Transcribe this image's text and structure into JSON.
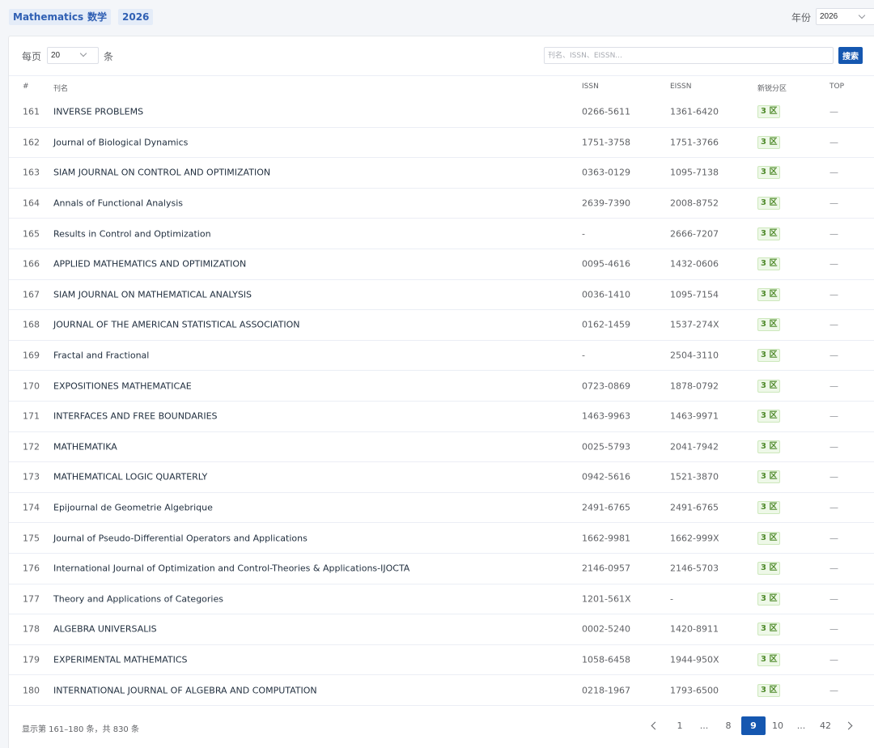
{
  "header": {
    "subject": "Mathematics",
    "subject_cn": "数学",
    "year_tag": "2026",
    "year_label": "年份",
    "year_value": "2026"
  },
  "toolbar": {
    "per_page_label": "每页",
    "per_page_value": "20",
    "per_page_unit": "条",
    "search_placeholder": "刊名、ISSN、EISSN...",
    "search_button": "搜索"
  },
  "table": {
    "columns": [
      "#",
      "刊名",
      "ISSN",
      "EISSN",
      "新锐分区",
      "TOP"
    ],
    "rows": [
      {
        "idx": "161",
        "name": "INVERSE PROBLEMS",
        "issn": "0266-5611",
        "eissn": "1361-6420",
        "zone": "3 区",
        "top": "—"
      },
      {
        "idx": "162",
        "name": "Journal of Biological Dynamics",
        "issn": "1751-3758",
        "eissn": "1751-3766",
        "zone": "3 区",
        "top": "—"
      },
      {
        "idx": "163",
        "name": "SIAM JOURNAL ON CONTROL AND OPTIMIZATION",
        "issn": "0363-0129",
        "eissn": "1095-7138",
        "zone": "3 区",
        "top": "—"
      },
      {
        "idx": "164",
        "name": "Annals of Functional Analysis",
        "issn": "2639-7390",
        "eissn": "2008-8752",
        "zone": "3 区",
        "top": "—"
      },
      {
        "idx": "165",
        "name": "Results in Control and Optimization",
        "issn": "-",
        "eissn": "2666-7207",
        "zone": "3 区",
        "top": "—"
      },
      {
        "idx": "166",
        "name": "APPLIED MATHEMATICS AND OPTIMIZATION",
        "issn": "0095-4616",
        "eissn": "1432-0606",
        "zone": "3 区",
        "top": "—"
      },
      {
        "idx": "167",
        "name": "SIAM JOURNAL ON MATHEMATICAL ANALYSIS",
        "issn": "0036-1410",
        "eissn": "1095-7154",
        "zone": "3 区",
        "top": "—"
      },
      {
        "idx": "168",
        "name": "JOURNAL OF THE AMERICAN STATISTICAL ASSOCIATION",
        "issn": "0162-1459",
        "eissn": "1537-274X",
        "zone": "3 区",
        "top": "—"
      },
      {
        "idx": "169",
        "name": "Fractal and Fractional",
        "issn": "-",
        "eissn": "2504-3110",
        "zone": "3 区",
        "top": "—"
      },
      {
        "idx": "170",
        "name": "EXPOSITIONES MATHEMATICAE",
        "issn": "0723-0869",
        "eissn": "1878-0792",
        "zone": "3 区",
        "top": "—"
      },
      {
        "idx": "171",
        "name": "INTERFACES AND FREE BOUNDARIES",
        "issn": "1463-9963",
        "eissn": "1463-9971",
        "zone": "3 区",
        "top": "—"
      },
      {
        "idx": "172",
        "name": "MATHEMATIKA",
        "issn": "0025-5793",
        "eissn": "2041-7942",
        "zone": "3 区",
        "top": "—"
      },
      {
        "idx": "173",
        "name": "MATHEMATICAL LOGIC QUARTERLY",
        "issn": "0942-5616",
        "eissn": "1521-3870",
        "zone": "3 区",
        "top": "—"
      },
      {
        "idx": "174",
        "name": "Epijournal de Geometrie Algebrique",
        "issn": "2491-6765",
        "eissn": "2491-6765",
        "zone": "3 区",
        "top": "—"
      },
      {
        "idx": "175",
        "name": "Journal of Pseudo-Differential Operators and Applications",
        "issn": "1662-9981",
        "eissn": "1662-999X",
        "zone": "3 区",
        "top": "—"
      },
      {
        "idx": "176",
        "name": "International Journal of Optimization and Control-Theories & Applications-IJOCTA",
        "issn": "2146-0957",
        "eissn": "2146-5703",
        "zone": "3 区",
        "top": "—"
      },
      {
        "idx": "177",
        "name": "Theory and Applications of Categories",
        "issn": "1201-561X",
        "eissn": "-",
        "zone": "3 区",
        "top": "—"
      },
      {
        "idx": "178",
        "name": "ALGEBRA UNIVERSALIS",
        "issn": "0002-5240",
        "eissn": "1420-8911",
        "zone": "3 区",
        "top": "—"
      },
      {
        "idx": "179",
        "name": "EXPERIMENTAL MATHEMATICS",
        "issn": "1058-6458",
        "eissn": "1944-950X",
        "zone": "3 区",
        "top": "—"
      },
      {
        "idx": "180",
        "name": "INTERNATIONAL JOURNAL OF ALGEBRA AND COMPUTATION",
        "issn": "0218-1967",
        "eissn": "1793-6500",
        "zone": "3 区",
        "top": "—"
      }
    ]
  },
  "footer": {
    "summary": "显示第 161–180 条，共 830 条",
    "pages": [
      "1",
      "...",
      "8",
      "9",
      "10",
      "...",
      "42"
    ],
    "current_page": "9"
  },
  "colors": {
    "accent": "#1557b0",
    "zone_bg": "#eef8e8",
    "zone_text": "#4f8a2b",
    "tag_bg": "#e4ecf8"
  },
  "icons": [
    "chevron-down-icon",
    "chevron-left-icon",
    "chevron-right-icon"
  ]
}
